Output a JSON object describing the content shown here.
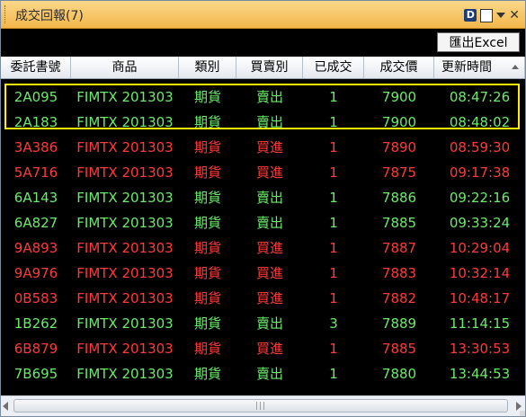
{
  "window": {
    "title": "成交回報(7)"
  },
  "titlebar_icons": [
    {
      "name": "d-app-icon",
      "glyph": "D"
    },
    {
      "name": "copy-icon",
      "glyph": ""
    },
    {
      "name": "dropdown-arrow-icon",
      "glyph": ""
    },
    {
      "name": "close-icon",
      "glyph": "✕"
    }
  ],
  "toolbar": {
    "export_label": "匯出Excel"
  },
  "columns": [
    "委託書號",
    "商品",
    "類別",
    "買賣別",
    "已成交",
    "成交價",
    "更新時間"
  ],
  "colors": {
    "sell": "#6dea6d",
    "buy": "#ff3a3a",
    "highlight": "#ffee00"
  },
  "rows": [
    {
      "order_id": "2A095",
      "product": "FIMTX 201303",
      "category": "期貨",
      "side": "賣出",
      "filled": "1",
      "price": "7900",
      "time": "08:47:26",
      "color": "sell"
    },
    {
      "order_id": "2A183",
      "product": "FIMTX 201303",
      "category": "期貨",
      "side": "賣出",
      "filled": "1",
      "price": "7900",
      "time": "08:48:02",
      "color": "sell"
    },
    {
      "order_id": "3A386",
      "product": "FIMTX 201303",
      "category": "期貨",
      "side": "買進",
      "filled": "1",
      "price": "7890",
      "time": "08:59:30",
      "color": "buy"
    },
    {
      "order_id": "5A716",
      "product": "FIMTX 201303",
      "category": "期貨",
      "side": "買進",
      "filled": "1",
      "price": "7875",
      "time": "09:17:38",
      "color": "buy"
    },
    {
      "order_id": "6A143",
      "product": "FIMTX 201303",
      "category": "期貨",
      "side": "賣出",
      "filled": "1",
      "price": "7886",
      "time": "09:22:16",
      "color": "sell"
    },
    {
      "order_id": "6A827",
      "product": "FIMTX 201303",
      "category": "期貨",
      "side": "賣出",
      "filled": "1",
      "price": "7885",
      "time": "09:33:24",
      "color": "sell"
    },
    {
      "order_id": "9A893",
      "product": "FIMTX 201303",
      "category": "期貨",
      "side": "買進",
      "filled": "1",
      "price": "7887",
      "time": "10:29:04",
      "color": "buy"
    },
    {
      "order_id": "9A976",
      "product": "FIMTX 201303",
      "category": "期貨",
      "side": "買進",
      "filled": "1",
      "price": "7883",
      "time": "10:32:14",
      "color": "buy"
    },
    {
      "order_id": "0B583",
      "product": "FIMTX 201303",
      "category": "期貨",
      "side": "買進",
      "filled": "1",
      "price": "7882",
      "time": "10:48:17",
      "color": "buy"
    },
    {
      "order_id": "1B262",
      "product": "FIMTX 201303",
      "category": "期貨",
      "side": "賣出",
      "filled": "3",
      "price": "7889",
      "time": "11:14:15",
      "color": "sell"
    },
    {
      "order_id": "6B879",
      "product": "FIMTX 201303",
      "category": "期貨",
      "side": "買進",
      "filled": "1",
      "price": "7885",
      "time": "13:30:53",
      "color": "buy"
    },
    {
      "order_id": "7B695",
      "product": "FIMTX 201303",
      "category": "期貨",
      "side": "賣出",
      "filled": "1",
      "price": "7880",
      "time": "13:44:53",
      "color": "sell"
    }
  ],
  "highlighted_rows": [
    0,
    1
  ],
  "scrollbar": {
    "grip": "|||"
  }
}
